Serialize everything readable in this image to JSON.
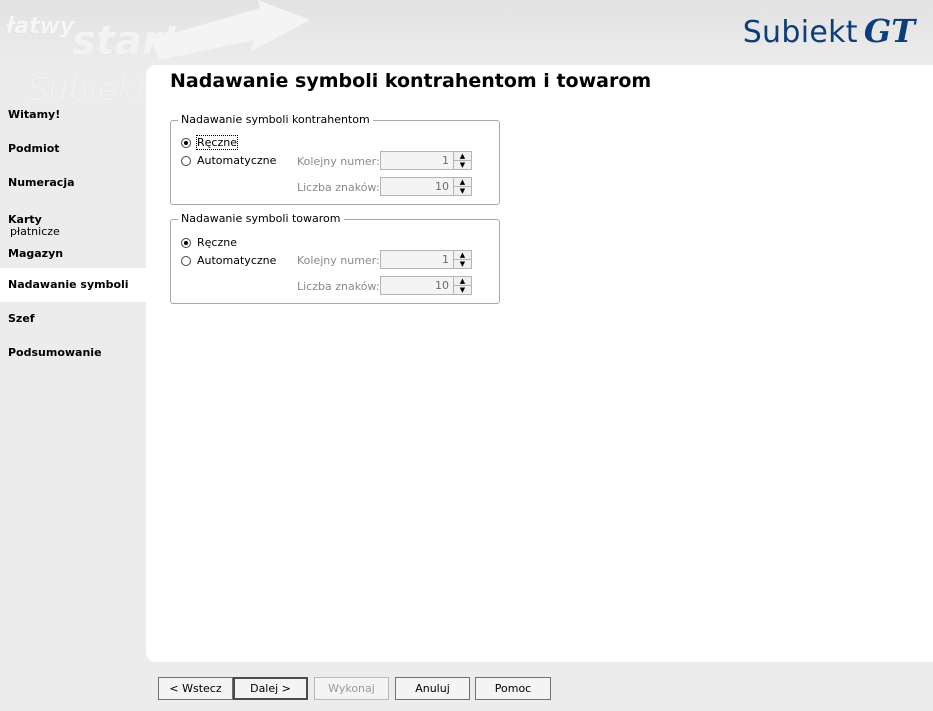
{
  "header": {
    "watermark_line1": "łatwy",
    "watermark_line2": "start",
    "watermark_line3": "Subiekt",
    "logo_text": "Subiekt",
    "logo_suffix": "GT",
    "logo_color": "#0d3e7a"
  },
  "sidebar": {
    "items": [
      {
        "label": "Witamy!",
        "active": false
      },
      {
        "label": "Podmiot",
        "active": false
      },
      {
        "label": "Numeracja",
        "active": false
      },
      {
        "label": "Karty",
        "sub": "płatnicze",
        "active": false
      },
      {
        "label": "Magazyn",
        "active": false
      },
      {
        "label": "Nadawanie symboli",
        "active": true
      },
      {
        "label": "Szef",
        "active": false
      },
      {
        "label": "Podsumowanie",
        "active": false
      }
    ]
  },
  "main": {
    "title": "Nadawanie symboli kontrahentom i towarom",
    "groups": [
      {
        "title": "Nadawanie symboli kontrahentom",
        "manual_label": "Ręczne",
        "auto_label": "Automatyczne",
        "selected": "manual",
        "next_number_label": "Kolejny numer:",
        "next_number_value": "1",
        "char_count_label": "Liczba znaków:",
        "char_count_value": "10"
      },
      {
        "title": "Nadawanie symboli towarom",
        "manual_label": "Ręczne",
        "auto_label": "Automatyczne",
        "selected": "manual",
        "next_number_label": "Kolejny numer:",
        "next_number_value": "1",
        "char_count_label": "Liczba znaków:",
        "char_count_value": "10"
      }
    ]
  },
  "buttons": {
    "back": "< Wstecz",
    "next": "Dalej >",
    "execute": "Wykonaj",
    "cancel": "Anuluj",
    "help": "Pomoc"
  }
}
